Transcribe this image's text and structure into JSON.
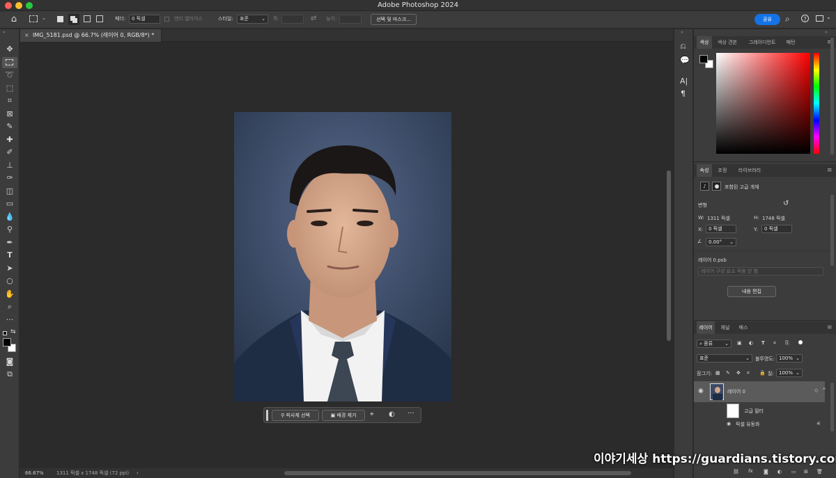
{
  "app": {
    "title": "Adobe Photoshop 2024"
  },
  "colors": {
    "accent": "#1473e6",
    "panel": "#3c3c3c",
    "canvas": "#2b2b2b"
  },
  "options": {
    "feather_label": "페더:",
    "feather_value": "0 픽셀",
    "antialias_label": "앤티 앨리어스",
    "style_label": "스타일:",
    "style_value": "표준",
    "width_label": "폭:",
    "height_label": "높이:",
    "select_mask_label": "선택 및 마스크...",
    "share_label": "공유"
  },
  "document": {
    "tab_title": "IMG_5181.psd @ 66.7% (레이어 0, RGB/8*) *",
    "zoom": "66.67%",
    "info": "1311 픽셀 x 1748 픽셀 (72 ppi)"
  },
  "contextbar": {
    "select_subject": "피사체 선택",
    "remove_bg": "배경 제거"
  },
  "color_panel": {
    "tabs": [
      "색상",
      "색상 견본",
      "그레이디언트",
      "패턴"
    ]
  },
  "properties_panel": {
    "tabs": [
      "속성",
      "조정",
      "라이브러리"
    ],
    "object_type": "포함된 고급 개체",
    "transform_label": "변형",
    "w_label": "W:",
    "w_value": "1311 픽셀",
    "h_label": "H:",
    "h_value": "1748 픽셀",
    "x_label": "X:",
    "x_value": "0 픽셀",
    "y_label": "Y:",
    "y_value": "0 픽셀",
    "angle_value": "0.00°",
    "file_name": "레이어 0.psb",
    "comp_placeholder": "레이어 구성 요소 적용 안 함",
    "edit_button": "내용 편집"
  },
  "layers_panel": {
    "tabs": [
      "레이어",
      "채널",
      "패스"
    ],
    "filter_kind": "종류",
    "blend_mode": "표준",
    "opacity_label": "불투명도:",
    "opacity_value": "100%",
    "lock_label": "잠그기:",
    "fill_label": "칠:",
    "fill_value": "100%",
    "layer_name": "레이어 0",
    "smart_filter_label": "고급 필터",
    "filter_name": "픽셀 유동화"
  },
  "watermark": "이야기세상 https://guardians.tistory.com"
}
